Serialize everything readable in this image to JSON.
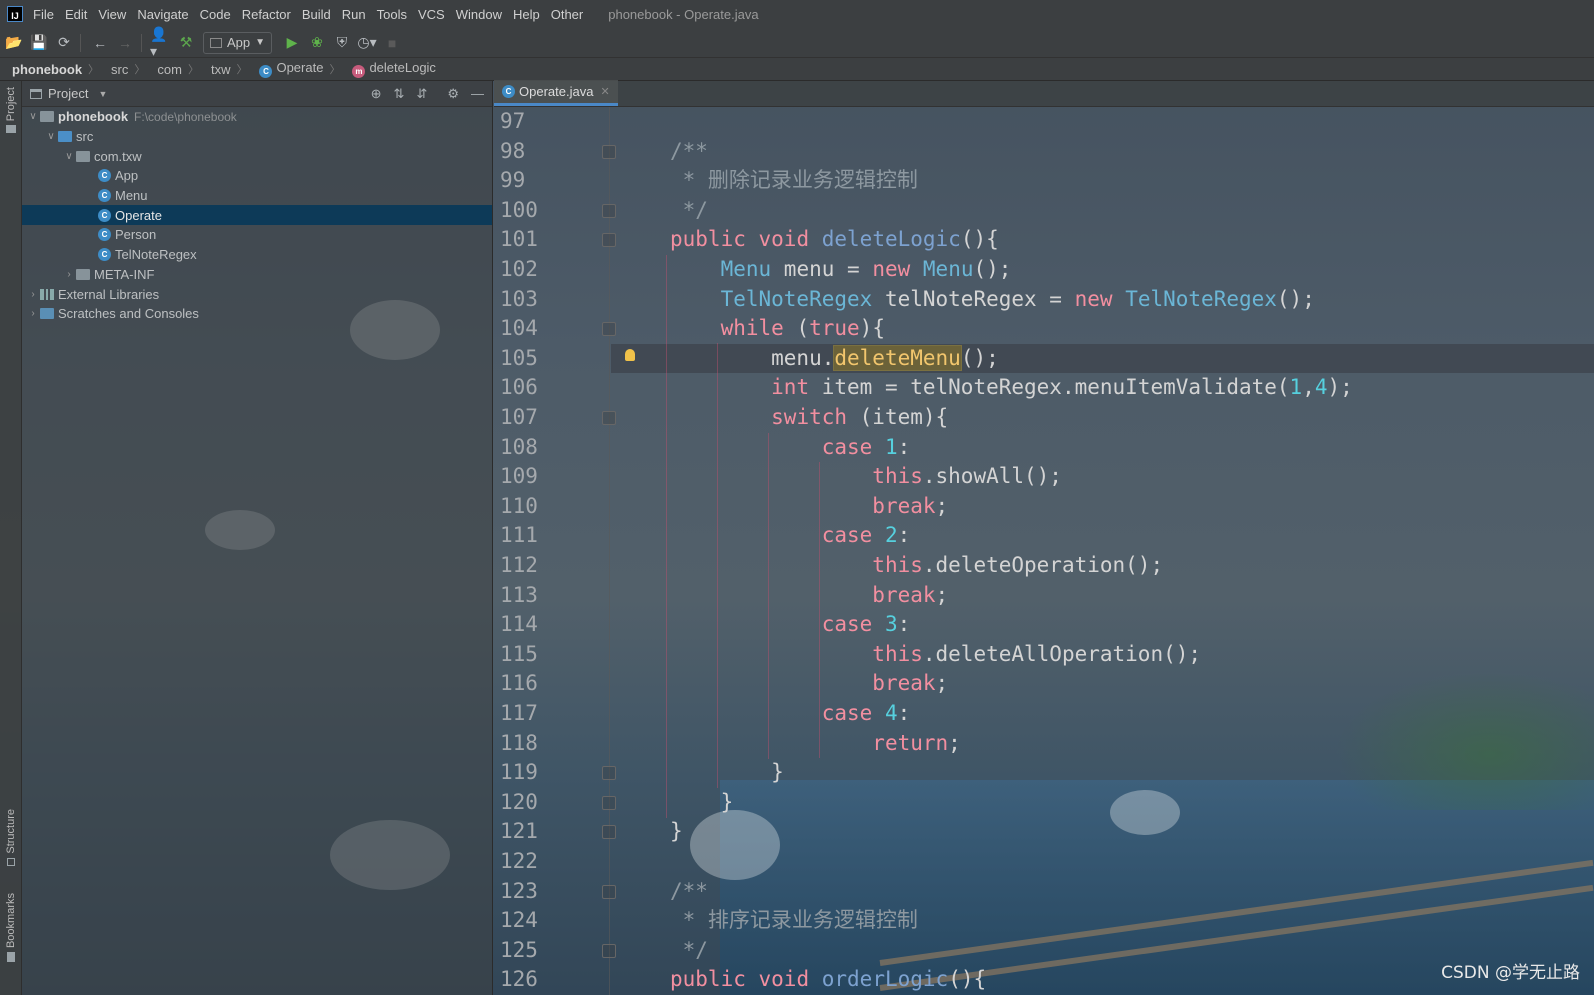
{
  "menubar": {
    "items": [
      "File",
      "Edit",
      "View",
      "Navigate",
      "Code",
      "Refactor",
      "Build",
      "Run",
      "Tools",
      "VCS",
      "Window",
      "Help",
      "Other"
    ],
    "title": "phonebook - Operate.java"
  },
  "toolbar": {
    "run_config": "App"
  },
  "breadcrumb": {
    "items": [
      "phonebook",
      "src",
      "com",
      "txw",
      "Operate",
      "deleteLogic"
    ]
  },
  "side_tabs": {
    "project": "Project",
    "structure": "Structure",
    "bookmarks": "Bookmarks"
  },
  "project_panel": {
    "title": "Project",
    "root": {
      "name": "phonebook",
      "path": "F:\\code\\phonebook"
    },
    "src": "src",
    "package": "com.txw",
    "classes": [
      "App",
      "Menu",
      "Operate",
      "Person",
      "TelNoteRegex"
    ],
    "selected": "Operate",
    "meta_inf": "META-INF",
    "external_libraries": "External Libraries",
    "scratches": "Scratches and Consoles"
  },
  "editor": {
    "tab": "Operate.java",
    "current_line": 105,
    "lines": [
      {
        "n": "97",
        "text": ""
      },
      {
        "n": "98",
        "text": "/**"
      },
      {
        "n": "99",
        "text": " * 删除记录业务逻辑控制"
      },
      {
        "n": "100",
        "text": " */"
      },
      {
        "n": "101",
        "text": "public void deleteLogic(){"
      },
      {
        "n": "102",
        "text": "    Menu menu = new Menu();"
      },
      {
        "n": "103",
        "text": "    TelNoteRegex telNoteRegex = new TelNoteRegex();"
      },
      {
        "n": "104",
        "text": "    while (true){"
      },
      {
        "n": "105",
        "text": "        menu.deleteMenu();"
      },
      {
        "n": "106",
        "text": "        int item = telNoteRegex.menuItemValidate(1,4);"
      },
      {
        "n": "107",
        "text": "        switch (item){"
      },
      {
        "n": "108",
        "text": "            case 1:"
      },
      {
        "n": "109",
        "text": "                this.showAll();"
      },
      {
        "n": "110",
        "text": "                break;"
      },
      {
        "n": "111",
        "text": "            case 2:"
      },
      {
        "n": "112",
        "text": "                this.deleteOperation();"
      },
      {
        "n": "113",
        "text": "                break;"
      },
      {
        "n": "114",
        "text": "            case 3:"
      },
      {
        "n": "115",
        "text": "                this.deleteAllOperation();"
      },
      {
        "n": "116",
        "text": "                break;"
      },
      {
        "n": "117",
        "text": "            case 4:"
      },
      {
        "n": "118",
        "text": "                return;"
      },
      {
        "n": "119",
        "text": "        }"
      },
      {
        "n": "120",
        "text": "    }"
      },
      {
        "n": "121",
        "text": "}"
      },
      {
        "n": "122",
        "text": ""
      },
      {
        "n": "123",
        "text": "/**"
      },
      {
        "n": "124",
        "text": " * 排序记录业务逻辑控制"
      },
      {
        "n": "125",
        "text": " */"
      },
      {
        "n": "126",
        "text": "public void orderLogic(){"
      }
    ]
  },
  "watermark": "CSDN @学无止路",
  "colors": {
    "keyword": "#f28fa0",
    "type": "#6bb6d6",
    "function": "#7da2d0",
    "comment": "#8d98a0",
    "number": "#56d0de",
    "selection": "#0d3a58",
    "tab_underline": "#4a88c7"
  }
}
